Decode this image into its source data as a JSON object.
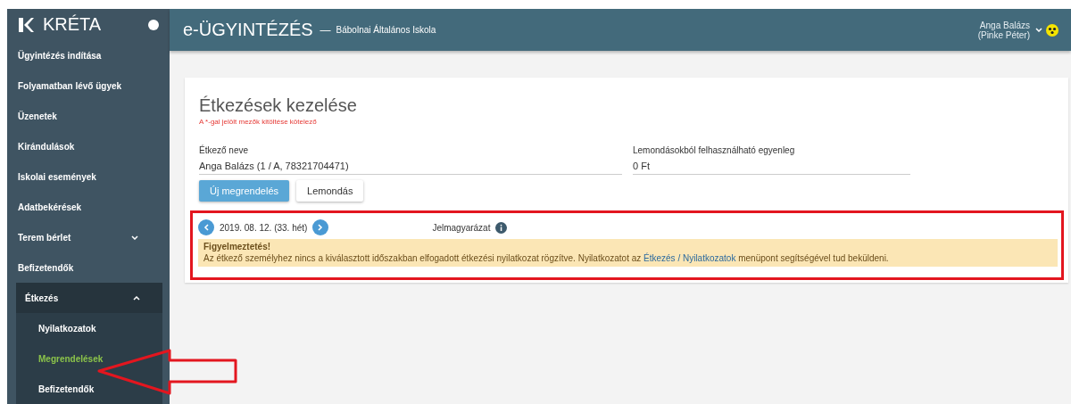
{
  "sidebar": {
    "logo_text": "KRÉTA",
    "items": [
      {
        "kind": "link",
        "label": "Ügyintézés indítása",
        "selected": false
      },
      {
        "kind": "link",
        "label": "Folyamatban lévő ügyek",
        "selected": false
      },
      {
        "kind": "link",
        "label": "Üzenetek",
        "selected": false
      },
      {
        "kind": "link",
        "label": "Kirándulások",
        "selected": false
      },
      {
        "kind": "link",
        "label": "Iskolai események",
        "selected": false
      },
      {
        "kind": "link",
        "label": "Adatbekérések",
        "selected": false
      },
      {
        "kind": "group",
        "label": "Terem bérlet",
        "selected": false,
        "expanded": false
      },
      {
        "kind": "link",
        "label": "Befizetendők",
        "selected": false
      },
      {
        "kind": "group",
        "label": "Étkezés",
        "selected": false,
        "expanded": true,
        "children": [
          {
            "label": "Nyilatkozatok",
            "selected": false
          },
          {
            "label": "Megrendelések",
            "selected": true
          },
          {
            "label": "Befizetendők",
            "selected": false
          }
        ]
      }
    ]
  },
  "header": {
    "title": "e-ÜGYINTÉZÉS",
    "separator": "—",
    "school": "Bábolnai Általános Iskola",
    "user_name": "Anga Balázs",
    "user_sub": "(Pinke Péter)"
  },
  "card": {
    "title": "Étkezések kezelése",
    "required_note": "A *-gal jelölt mezők kitöltése kötelező",
    "fields": [
      {
        "label": "Étkező neve",
        "value": "Anga Balázs (1 / A, 78321704471)"
      },
      {
        "label": "Lemondásokból felhasználható egyenleg",
        "value": "0 Ft"
      }
    ],
    "buttons": [
      {
        "label": "Új megrendelés",
        "kind": "primary"
      },
      {
        "label": "Lemondás",
        "kind": "default"
      }
    ],
    "week": {
      "date": "2019. 08. 12. (33. hét)",
      "legend": "Jelmagyarázat"
    },
    "alert": {
      "title": "Figyelmeztetés!",
      "text_before": "Az étkező személyhez nincs a kiválasztott időszakban elfogadott étkezési nyilatkozat rögzítve. Nyilatkozatot az",
      "link": "Étkezés / Nyilatkozatok",
      "text_after": "menüpont segítségével tud beküldeni."
    }
  }
}
